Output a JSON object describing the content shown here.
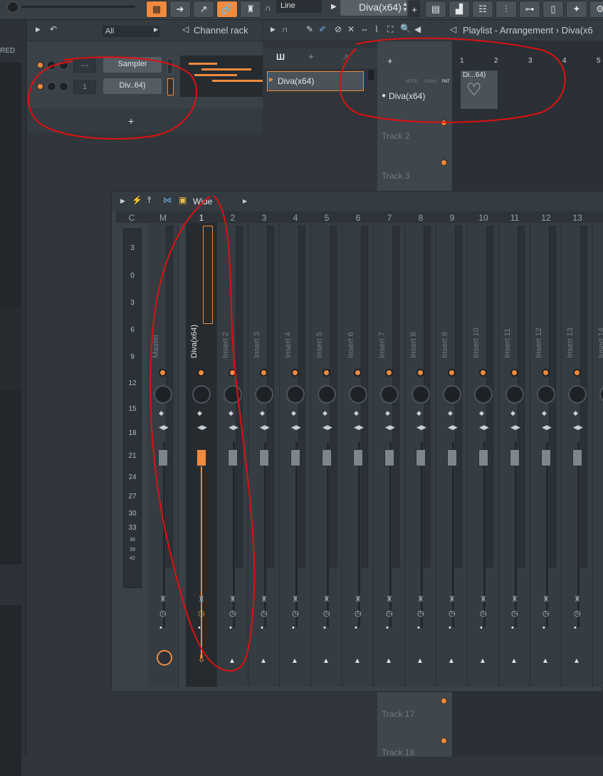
{
  "toolbar": {
    "snap_label": "Line",
    "pattern_name": "Diva(x64)",
    "add_label": "+"
  },
  "left_panel": {
    "label": "RED"
  },
  "channel_rack": {
    "filter_label": "All",
    "title": "Channel rack",
    "channels": [
      {
        "num": "---",
        "name": "Sampler"
      },
      {
        "num": "1",
        "name": "Div..64)"
      }
    ],
    "add_label": "+"
  },
  "playlist": {
    "title": "Playlist - Arrangement › Diva(x6",
    "browser_pattern": "Diva(x64)",
    "tabs": [
      "NOTE",
      "CHAN",
      "PAT"
    ],
    "tracks": [
      {
        "label": "Diva(x64)"
      },
      {
        "label": "Track 2"
      },
      {
        "label": "Track 3"
      }
    ],
    "ruler": [
      "1",
      "2",
      "3",
      "4",
      "5"
    ],
    "clip_label": "Di...64)",
    "lower_tracks": [
      "Track 17",
      "Track 18"
    ],
    "add_label": "+"
  },
  "mixer": {
    "preset_label": "Wide",
    "numbers": [
      "C",
      "M",
      "1",
      "2",
      "3",
      "4",
      "5",
      "6",
      "7",
      "8",
      "9",
      "10",
      "11",
      "12",
      "13"
    ],
    "db_scale": [
      "3",
      "0",
      "3",
      "6",
      "9",
      "12",
      "15",
      "18",
      "21",
      "24",
      "27",
      "30",
      "33",
      "36",
      "39",
      "42"
    ],
    "strips": [
      "Master",
      "Diva(x64)",
      "Insert 2",
      "Insert 3",
      "Insert 4",
      "Insert 5",
      "Insert 6",
      "Insert 7",
      "Insert 8",
      "Insert 9",
      "Insert 10",
      "Insert 11",
      "Insert 12",
      "Insert 13",
      "Insert 14"
    ]
  },
  "colors": {
    "accent": "#f08a3e",
    "annotation": "#e01010"
  }
}
